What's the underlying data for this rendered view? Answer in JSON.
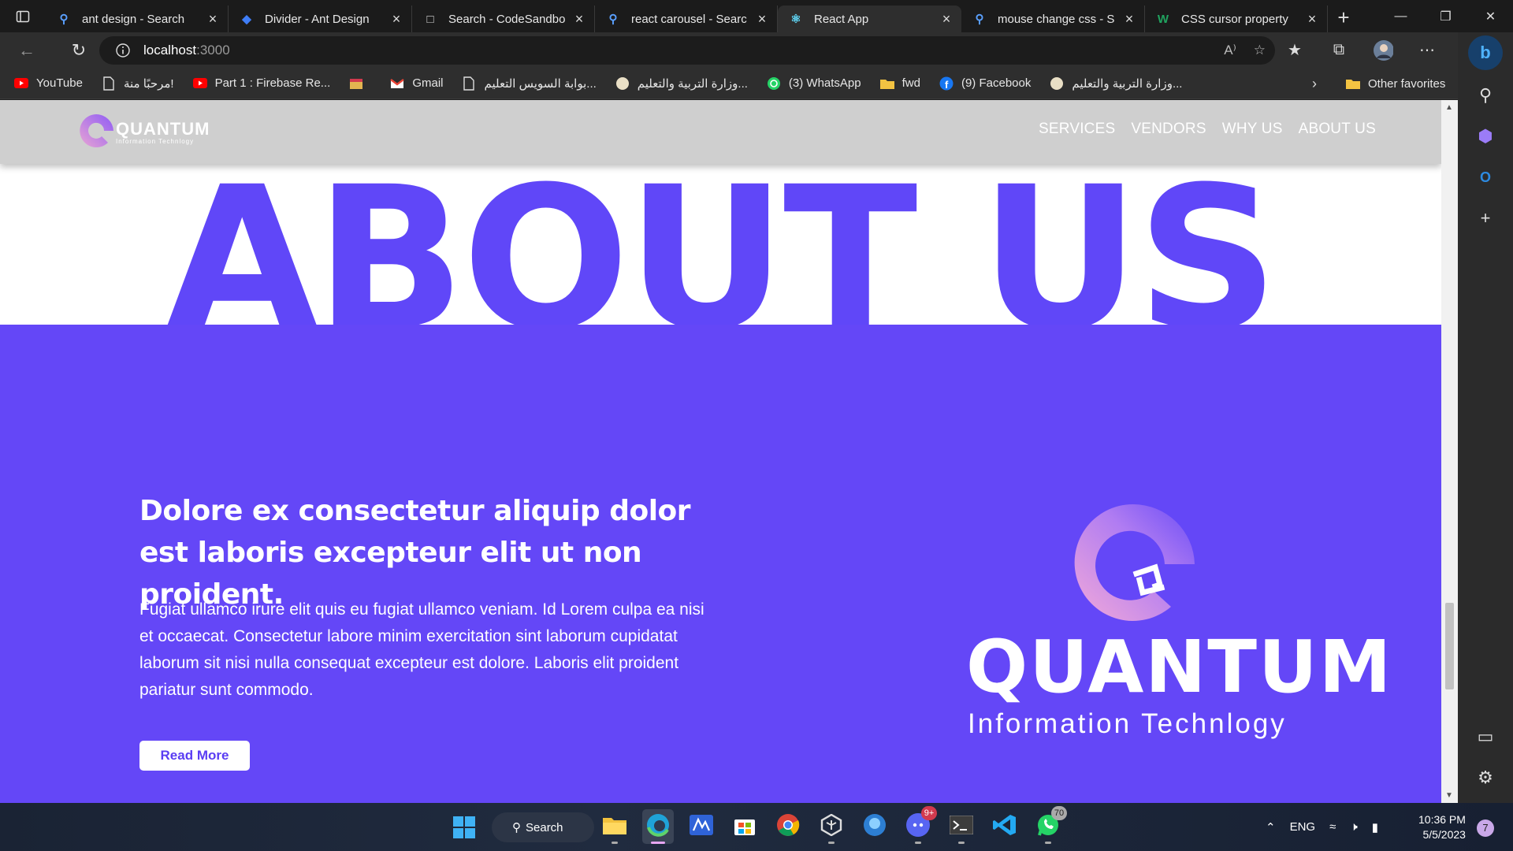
{
  "browser": {
    "tabs": [
      {
        "title": "ant design - Search",
        "icon": "search-icon",
        "active": false
      },
      {
        "title": "Divider - Ant Design",
        "icon": "ant-design-icon",
        "active": false
      },
      {
        "title": "Search - CodeSandbo",
        "icon": "codesandbox-icon",
        "active": false
      },
      {
        "title": "react carousel - Searc",
        "icon": "search-icon",
        "active": false
      },
      {
        "title": "React App",
        "icon": "react-icon",
        "active": true
      },
      {
        "title": "mouse change css - S",
        "icon": "search-icon",
        "active": false
      },
      {
        "title": "CSS cursor property",
        "icon": "w3schools-icon",
        "active": false
      }
    ],
    "address": {
      "host": "localhost",
      "port": ":3000"
    },
    "bookmarks": [
      {
        "label": "YouTube",
        "icon": "youtube-icon"
      },
      {
        "label": "مرحبًا منة!",
        "icon": "document-icon"
      },
      {
        "label": "Part 1 : Firebase Re...",
        "icon": "youtube-icon"
      },
      {
        "label": "",
        "icon": "store-icon"
      },
      {
        "label": "Gmail",
        "icon": "gmail-icon"
      },
      {
        "label": "بوابة السويس التعليم...",
        "icon": "document-icon"
      },
      {
        "label": "وزارة التربية والتعليم...",
        "icon": "ministry-icon"
      },
      {
        "label": "(3) WhatsApp",
        "icon": "whatsapp-icon"
      },
      {
        "label": "fwd",
        "icon": "folder-icon"
      },
      {
        "label": "(9) Facebook",
        "icon": "facebook-icon"
      },
      {
        "label": "وزارة التربية والتعليم...",
        "icon": "ministry-icon"
      }
    ],
    "other_favorites": "Other favorites"
  },
  "site": {
    "logo": {
      "name": "QUANTUM",
      "tagline": "Information Technlogy"
    },
    "nav": [
      "SERVICES",
      "VENDORS",
      "WHY US",
      "ABOUT US"
    ],
    "hero_title": "ABOUT US",
    "about": {
      "heading": "Dolore ex consectetur aliquip dolor est laboris excepteur elit ut non proident.",
      "body": "Fugiat ullamco irure elit quis eu fugiat ullamco veniam. Id Lorem culpa ea nisi et occaecat. Consectetur labore minim exercitation sint laborum cupidatat laborum sit nisi nulla consequat excepteur est dolore. Laboris elit proident pariatur sunt commodo.",
      "button": "Read More"
    },
    "colors": {
      "accent": "#6447f7",
      "header_bg": "#cfcfcf"
    }
  },
  "taskbar": {
    "search_label": "Search",
    "apps": [
      {
        "name": "file-explorer-icon",
        "badge": ""
      },
      {
        "name": "edge-icon",
        "badge": "",
        "active": true
      },
      {
        "name": "mathway-icon",
        "badge": ""
      },
      {
        "name": "microsoft-store-icon",
        "badge": ""
      },
      {
        "name": "chrome-icon",
        "badge": ""
      },
      {
        "name": "unity-icon",
        "badge": ""
      },
      {
        "name": "sourcetree-icon",
        "badge": ""
      },
      {
        "name": "discord-icon",
        "badge": "9+"
      },
      {
        "name": "terminal-icon",
        "badge": ""
      },
      {
        "name": "vscode-icon",
        "badge": ""
      },
      {
        "name": "whatsapp-icon",
        "badge": "70"
      }
    ],
    "language": "ENG",
    "time": "10:36 PM",
    "date": "5/5/2023",
    "notifications": "7"
  }
}
